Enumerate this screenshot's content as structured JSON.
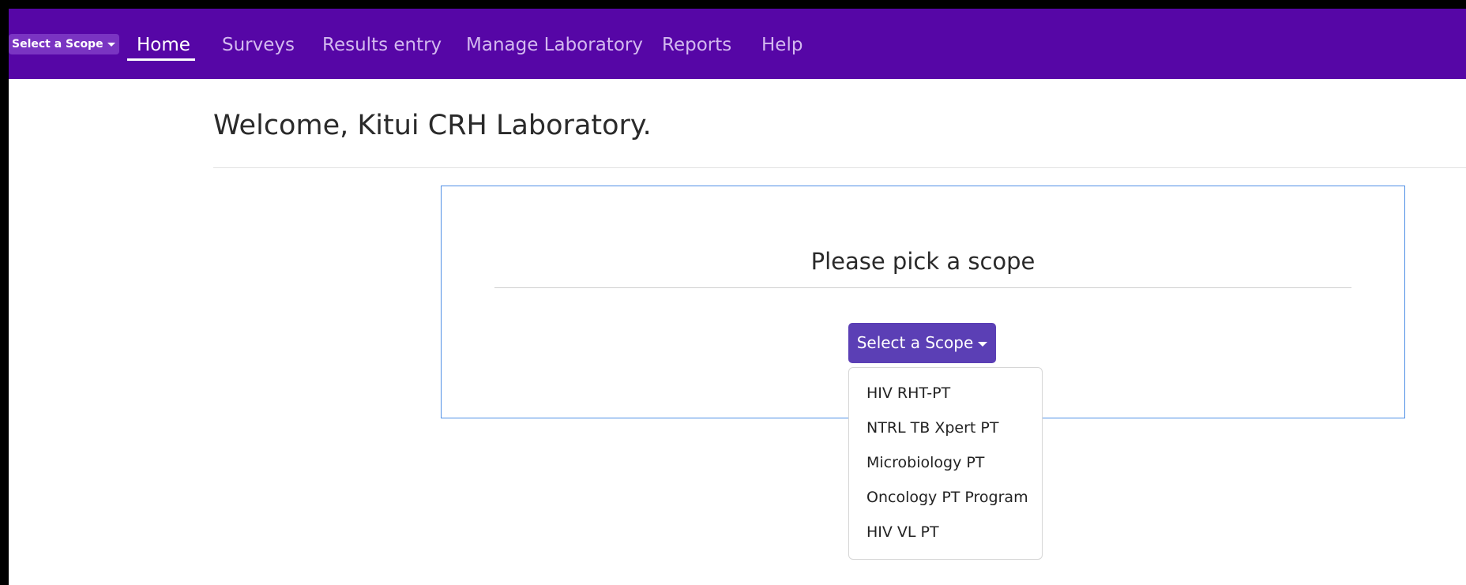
{
  "navbar": {
    "scope_mini_label": "Select a Scope",
    "links": [
      {
        "label": "Home",
        "active": true
      },
      {
        "label": "Surveys"
      },
      {
        "label": "Results entry"
      },
      {
        "label": "Manage Laboratory"
      },
      {
        "label": "Reports"
      },
      {
        "label": "Help"
      }
    ],
    "colors": {
      "background": "#5606a6",
      "active_text": "#ffffff",
      "inactive_text": "#d3b8ef"
    }
  },
  "welcome": {
    "text": "Welcome, Kitui CRH Laboratory."
  },
  "scope_card": {
    "title": "Please pick a scope",
    "button_label": "Select a Scope",
    "options": [
      "HIV RHT-PT",
      "NTRL TB Xpert PT",
      "Microbiology PT",
      "Oncology PT Program",
      "HIV VL PT"
    ],
    "colors": {
      "button": "#5b3fb5",
      "card_border": "#4f8fe6"
    }
  },
  "icons": {
    "dropdown_caret": "caret-down-icon"
  }
}
